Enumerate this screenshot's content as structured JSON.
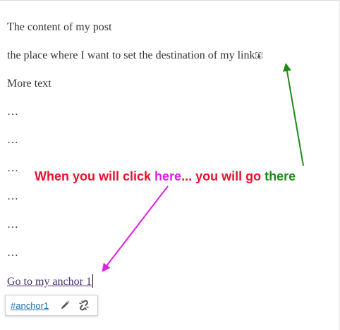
{
  "editor": {
    "paragraphs": [
      "The content of my post",
      "the place where I want to set the destination of my link",
      "More text",
      "…",
      "…",
      "…",
      "…",
      "…",
      "…"
    ],
    "link_text": "Go to my anchor 1"
  },
  "annotation": {
    "part1": "When you will click ",
    "part2": "here",
    "part3": "... you will go ",
    "part4": "there",
    "colors": {
      "red": "#e8112d",
      "magenta": "#e11de6",
      "green": "#1f8a18"
    }
  },
  "link_toolbar": {
    "anchor_label": "#anchor1",
    "edit_icon": "pencil-icon",
    "unlink_icon": "broken-link-icon"
  }
}
